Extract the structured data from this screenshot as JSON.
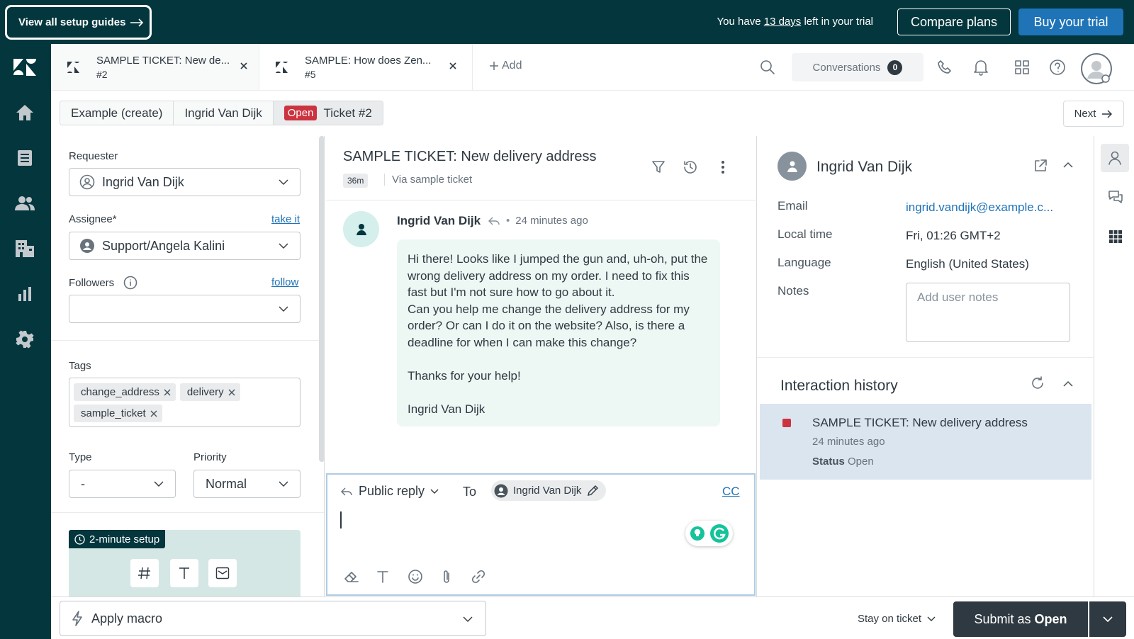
{
  "trial_bar": {
    "setup_guides": "View all setup guides",
    "trial_prefix": "You have",
    "trial_days": "13 days",
    "trial_suffix": "left in your trial",
    "compare_plans": "Compare plans",
    "buy_trial": "Buy your trial"
  },
  "tabs": [
    {
      "title": "SAMPLE TICKET: New de...",
      "number": "#2"
    },
    {
      "title": "SAMPLE: How does Zen...",
      "number": "#5"
    }
  ],
  "add_tab": "Add",
  "header": {
    "conversations_label": "Conversations",
    "conversations_count": "0"
  },
  "breadcrumbs": {
    "org": "Example (create)",
    "user": "Ingrid Van Dijk",
    "status_badge": "Open",
    "ticket": "Ticket #2",
    "next": "Next"
  },
  "properties": {
    "requester_label": "Requester",
    "requester_value": "Ingrid Van Dijk",
    "assignee_label": "Assignee*",
    "take_it": "take it",
    "assignee_value": "Support/Angela Kalini",
    "followers_label": "Followers",
    "follow": "follow",
    "tags_label": "Tags",
    "tags": [
      "change_address",
      "delivery",
      "sample_ticket"
    ],
    "type_label": "Type",
    "type_value": "-",
    "priority_label": "Priority",
    "priority_value": "Normal",
    "setup_badge": "2-minute setup"
  },
  "conversation": {
    "title": "SAMPLE TICKET: New delivery address",
    "age": "36m",
    "via": "Via sample ticket",
    "author": "Ingrid Van Dijk",
    "time": "24 minutes ago",
    "body": "Hi there! Looks like I jumped the gun and, uh-oh, put the wrong delivery address on my order. I need to fix this fast but I'm not sure how to go about it.\nCan you help me change the delivery address for my order? Or can I do it on the website? Also, is there a deadline for when I can make this change?\n\nThanks for your help!\n\nIngrid Van Dijk"
  },
  "composer": {
    "reply_type": "Public reply",
    "to_label": "To",
    "to_recipient": "Ingrid Van Dijk",
    "cc": "CC"
  },
  "user_panel": {
    "name": "Ingrid Van Dijk",
    "email_label": "Email",
    "email": "ingrid.vandijk@example.c...",
    "local_time_label": "Local time",
    "local_time": "Fri, 01:26 GMT+2",
    "language_label": "Language",
    "language": "English (United States)",
    "notes_label": "Notes",
    "notes_placeholder": "Add user notes"
  },
  "interaction_history": {
    "title": "Interaction history",
    "item_title": "SAMPLE TICKET: New delivery address",
    "item_time": "24 minutes ago",
    "item_status_label": "Status",
    "item_status": "Open"
  },
  "footer": {
    "apply_macro": "Apply macro",
    "stay_on_ticket": "Stay on ticket",
    "submit_prefix": "Submit as",
    "submit_status": "Open"
  },
  "colors": {
    "brand_dark": "#03363d",
    "primary_blue": "#1f73b7",
    "open_red": "#cc3340",
    "submit_dark": "#2f3941",
    "bubble_bg": "#edf8f4",
    "history_bg": "#dae5f0"
  }
}
